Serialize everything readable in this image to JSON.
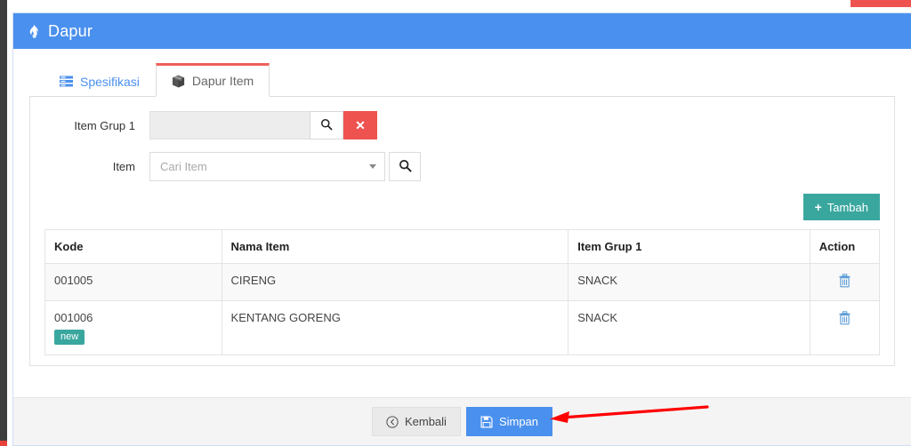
{
  "window": {
    "header": {
      "title": "Dapur",
      "icon": "flame-icon",
      "bg_color": "#4a90ee"
    }
  },
  "tabs": [
    {
      "label": "Spesifikasi",
      "icon": "server-list-icon",
      "active": false
    },
    {
      "label": "Dapur Item",
      "icon": "cube-box-icon",
      "active": true
    }
  ],
  "form": {
    "fields": [
      {
        "label": "Item Grup 1",
        "value": "",
        "placeholder": "",
        "disabled": true,
        "search_icon": "search-icon",
        "clear_icon": "times-icon"
      },
      {
        "label": "Item",
        "value": "",
        "placeholder": "Cari Item",
        "disabled": false,
        "caret_icon": "chevron-down-icon",
        "search_icon": "search-icon"
      }
    ],
    "add_button": {
      "label": "Tambah",
      "plus": "+",
      "color": "#3aa79f"
    }
  },
  "table": {
    "columns": [
      "Kode",
      "Nama Item",
      "Item Grup 1",
      "Action"
    ],
    "rows": [
      {
        "kode": "001005",
        "badge": "",
        "nama_item": "CIRENG",
        "item_grup_1": "SNACK",
        "action_icon": "trash-icon"
      },
      {
        "kode": "001006",
        "badge": "new",
        "nama_item": "KENTANG GORENG",
        "item_grup_1": "SNACK",
        "action_icon": "trash-icon"
      }
    ],
    "badge_color": "#3aa79f"
  },
  "footer": {
    "back_button": {
      "label": "Kembali",
      "icon": "arrow-circle-left-icon"
    },
    "save_button": {
      "label": "Simpan",
      "icon": "floppy-save-icon",
      "color": "#4a90ee"
    }
  },
  "annotation": {
    "arrow_color": "#ff0000",
    "points_to": "Simpan"
  }
}
